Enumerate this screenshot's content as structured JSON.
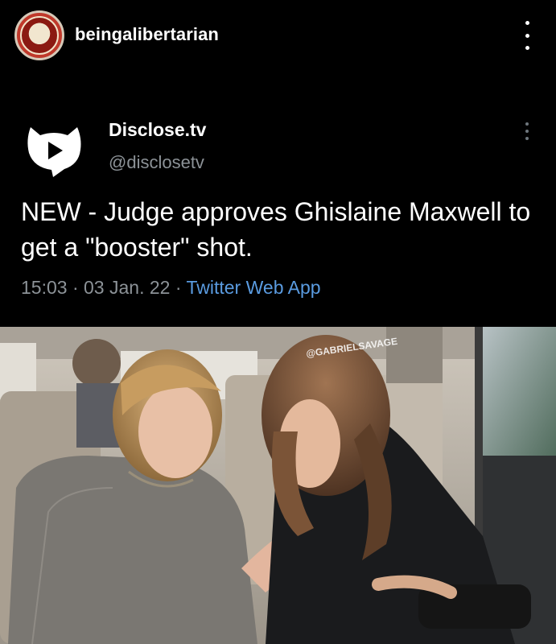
{
  "post": {
    "username": "beingalibertarian"
  },
  "tweet": {
    "display_name": "Disclose.tv",
    "handle": "@disclosetv",
    "text": "NEW - Judge approves Ghislaine Maxwell to get a \"booster\" shot.",
    "time": "15:03",
    "date": "03 Jan. 22",
    "separator": "·",
    "source": "Twitter Web App"
  },
  "photo": {
    "watermark": "@GABRIELSAVAGE"
  },
  "icons": {
    "avatar": "profile-avatar",
    "more": "more-vertical-icon",
    "tweet_logo": "disclose-tv-logo",
    "tweet_more": "more-vertical-icon"
  },
  "colors": {
    "background": "#000000",
    "text": "#ffffff",
    "muted": "#8c9297",
    "link": "#5a9be0"
  }
}
